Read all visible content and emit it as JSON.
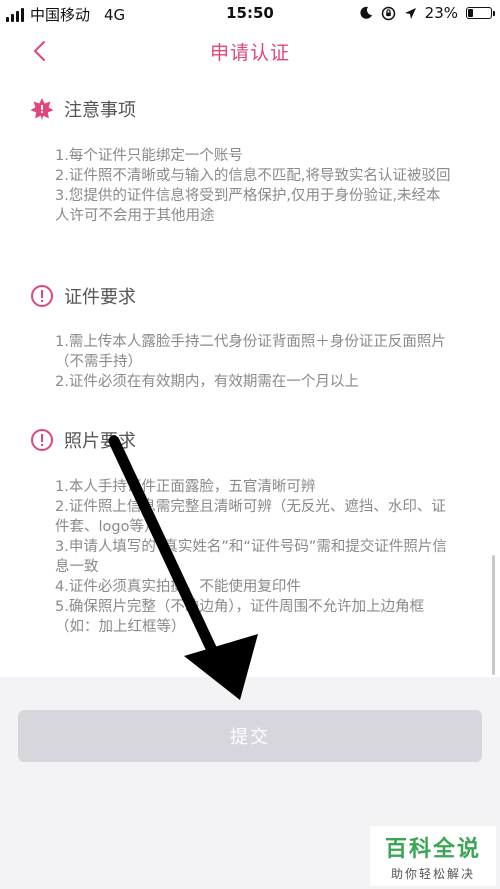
{
  "status_bar": {
    "carrier": "中国移动",
    "network": "4G",
    "time": "15:50",
    "battery": "23%",
    "battery_level": 0.23
  },
  "nav": {
    "title": "申请认证"
  },
  "sections": {
    "notice": {
      "title": "注意事项",
      "lines": [
        "1.每个证件只能绑定一个账号",
        "2.证件照不清晰或与输入的信息不匹配,将导致实名认证被驳回",
        "3.您提供的证件信息将受到严格保护,仅用于身份验证,未经本人许可不会用于其他用途"
      ]
    },
    "doc_req": {
      "title": "证件要求",
      "lines": [
        "1.需上传本人露脸手持二代身份证背面照＋身份证正反面照片（不需手持）",
        "2.证件必须在有效期内，有效期需在一个月以上"
      ]
    },
    "photo_req": {
      "title": "照片要求",
      "lines": [
        "1.本人手持证件正面露脸，五官清晰可辨",
        "2.证件照上信息需完整且清晰可辨（无反光、遮挡、水印、证件套、logo等）",
        "3.申请人填写的“真实姓名”和“证件号码”需和提交证件照片信息一致",
        "4.证件必须真实拍摄，不能使用复印件",
        "5.确保照片完整（不缺边角），证件周围不允许加上边角框（如：加上红框等）"
      ]
    }
  },
  "submit": {
    "label": "提交"
  },
  "watermark": {
    "main": "百科全说",
    "sub": "助你轻松解决"
  },
  "colors": {
    "accent": "#e0467c",
    "button_disabled": "#d6d6dc",
    "watermark": "#3aa655"
  }
}
